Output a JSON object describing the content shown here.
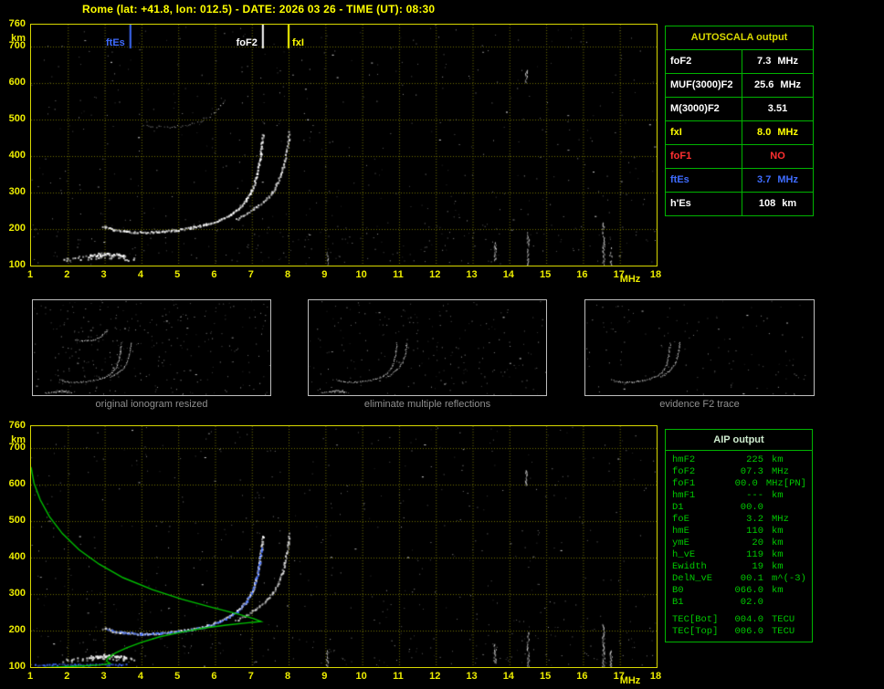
{
  "title": "Rome (lat: +41.8, lon: 012.5) - DATE: 2026 03 26 - TIME (UT): 08:30",
  "colors": {
    "frame": "#d8d800",
    "grid": "#6f6f00",
    "tick": "#ecec00",
    "trace": "#e0e0e0",
    "noise": "#a8a8a8",
    "profile": "#00c000",
    "fit": "#3f6cff",
    "table_green": "#00b400",
    "caption": "#8f8f8f"
  },
  "axes": {
    "f_min": 1,
    "f_max": 18,
    "h_min": 100,
    "h_max": 760,
    "x_ticks": [
      1,
      2,
      3,
      4,
      5,
      6,
      7,
      8,
      9,
      10,
      11,
      12,
      13,
      14,
      15,
      16,
      17,
      18
    ],
    "y_ticks": [
      760,
      700,
      600,
      500,
      400,
      300,
      200,
      100
    ],
    "x_unit": "MHz",
    "y_unit": "km"
  },
  "markers": [
    {
      "label": "ftEs",
      "f": 3.7,
      "color": "#3f6cff",
      "side": "left"
    },
    {
      "label": "foF2",
      "f": 7.3,
      "color": "#ffffff",
      "side": "left"
    },
    {
      "label": "fxI",
      "f": 8.0,
      "color": "#ffff00",
      "side": "right"
    }
  ],
  "autoscala": {
    "title": "AUTOSCALA output",
    "rows": [
      {
        "label": "foF2",
        "value": "7.3",
        "unit": "MHz",
        "color": "#ffffff"
      },
      {
        "label": "MUF(3000)F2",
        "value": "25.6",
        "unit": "MHz",
        "color": "#ffffff"
      },
      {
        "label": "M(3000)F2",
        "value": "3.51",
        "unit": "",
        "color": "#ffffff"
      },
      {
        "label": "fxI",
        "value": "8.0",
        "unit": "MHz",
        "color": "#ffff00"
      },
      {
        "label": "foF1",
        "value": "NO",
        "unit": "",
        "color": "#ff3030"
      },
      {
        "label": "ftEs",
        "value": "3.7",
        "unit": "MHz",
        "color": "#3f6cff"
      },
      {
        "label": "h'Es",
        "value": "108",
        "unit": "km",
        "color": "#ffffff"
      }
    ]
  },
  "thumbs": [
    {
      "caption": "original ionogram resized"
    },
    {
      "caption": "eliminate multiple reflections"
    },
    {
      "caption": "evidence F2 trace"
    }
  ],
  "aip": {
    "title": "AIP output",
    "rows": [
      {
        "label": "hmF2",
        "value": "225",
        "unit": "km",
        "extra": ""
      },
      {
        "label": "foF2",
        "value": "07.3",
        "unit": "MHz",
        "extra": ""
      },
      {
        "label": "foF1",
        "value": "00.0",
        "unit": "MHz",
        "extra": "[PN]"
      },
      {
        "label": "hmF1",
        "value": "---",
        "unit": "km",
        "extra": ""
      },
      {
        "label": "D1",
        "value": "00.0",
        "unit": "",
        "extra": ""
      },
      {
        "label": "foE",
        "value": "3.2",
        "unit": "MHz",
        "extra": ""
      },
      {
        "label": "hmE",
        "value": "110",
        "unit": "km",
        "extra": ""
      },
      {
        "label": "ymE",
        "value": "20",
        "unit": "km",
        "extra": ""
      },
      {
        "label": "h_vE",
        "value": "119",
        "unit": "km",
        "extra": ""
      },
      {
        "label": "Ewidth",
        "value": "19",
        "unit": "km",
        "extra": ""
      },
      {
        "label": "DelN_vE",
        "value": "00.1",
        "unit": "m^(-3)",
        "extra": ""
      },
      {
        "label": "B0",
        "value": "066.0",
        "unit": "km",
        "extra": ""
      },
      {
        "label": "B1",
        "value": "02.0",
        "unit": "",
        "extra": ""
      }
    ],
    "tec_rows": [
      {
        "label": "TEC[Bot]",
        "value": "004.0",
        "unit": "TECU",
        "extra": ""
      },
      {
        "label": "TEC[Top]",
        "value": "006.0",
        "unit": "TECU",
        "extra": ""
      }
    ]
  },
  "ionogram": {
    "traces": {
      "es_layer": [
        [
          1.85,
          118
        ],
        [
          2.15,
          121
        ],
        [
          2.5,
          124
        ],
        [
          2.85,
          126
        ],
        [
          3.2,
          126
        ],
        [
          3.5,
          123
        ],
        [
          3.78,
          119
        ]
      ],
      "es_blob": [
        [
          2.6,
          128
        ],
        [
          2.85,
          132
        ],
        [
          3.1,
          134
        ],
        [
          3.35,
          131
        ],
        [
          3.55,
          127
        ]
      ],
      "f_ordinary": [
        [
          2.95,
          208
        ],
        [
          3.25,
          199
        ],
        [
          3.6,
          194
        ],
        [
          4.0,
          192
        ],
        [
          4.45,
          194
        ],
        [
          4.9,
          198
        ],
        [
          5.35,
          205
        ],
        [
          5.75,
          214
        ],
        [
          6.1,
          226
        ],
        [
          6.4,
          241
        ],
        [
          6.65,
          260
        ],
        [
          6.85,
          283
        ],
        [
          7.0,
          310
        ],
        [
          7.1,
          340
        ],
        [
          7.17,
          372
        ],
        [
          7.22,
          405
        ],
        [
          7.26,
          437
        ],
        [
          7.285,
          462
        ]
      ],
      "f_extra": [
        [
          6.55,
          228
        ],
        [
          6.85,
          244
        ],
        [
          7.1,
          261
        ],
        [
          7.35,
          281
        ],
        [
          7.55,
          304
        ],
        [
          7.7,
          330
        ],
        [
          7.8,
          357
        ],
        [
          7.88,
          386
        ],
        [
          7.94,
          416
        ],
        [
          7.98,
          444
        ],
        [
          8.0,
          466
        ]
      ],
      "second_hop": [
        [
          4.05,
          484
        ],
        [
          4.45,
          481
        ],
        [
          4.9,
          481
        ],
        [
          5.3,
          487
        ],
        [
          5.65,
          499
        ],
        [
          5.95,
          517
        ],
        [
          6.15,
          537
        ],
        [
          6.28,
          554
        ]
      ],
      "profile": [
        [
          1.0,
          97
        ],
        [
          1.7,
          100
        ],
        [
          2.4,
          103
        ],
        [
          2.9,
          106
        ],
        [
          3.15,
          110
        ],
        [
          3.05,
          117
        ],
        [
          3.1,
          126
        ],
        [
          3.3,
          139
        ],
        [
          3.6,
          153
        ],
        [
          4.0,
          168
        ],
        [
          4.5,
          183
        ],
        [
          5.1,
          196
        ],
        [
          5.7,
          207
        ],
        [
          6.3,
          215
        ],
        [
          6.85,
          221
        ],
        [
          7.25,
          225
        ],
        [
          7.05,
          233
        ],
        [
          6.6,
          246
        ],
        [
          5.9,
          264
        ],
        [
          5.1,
          286
        ],
        [
          4.3,
          312
        ],
        [
          3.5,
          345
        ],
        [
          2.85,
          382
        ],
        [
          2.3,
          422
        ],
        [
          1.85,
          466
        ],
        [
          1.5,
          512
        ],
        [
          1.25,
          558
        ],
        [
          1.08,
          604
        ],
        [
          1.0,
          648
        ]
      ],
      "fit_f": [
        [
          3.05,
          203
        ],
        [
          3.5,
          196
        ],
        [
          4.0,
          192
        ],
        [
          4.5,
          194
        ],
        [
          5.0,
          199
        ],
        [
          5.5,
          207
        ],
        [
          5.95,
          218
        ],
        [
          6.3,
          234
        ],
        [
          6.6,
          254
        ],
        [
          6.85,
          280
        ],
        [
          7.02,
          312
        ],
        [
          7.12,
          348
        ],
        [
          7.2,
          388
        ],
        [
          7.25,
          428
        ]
      ],
      "fit_es": [
        [
          1.1,
          108
        ],
        [
          1.6,
          108
        ],
        [
          2.1,
          108
        ],
        [
          2.6,
          108
        ],
        [
          3.1,
          108
        ],
        [
          3.55,
          108
        ]
      ]
    },
    "streaks": [
      {
        "f": 14.5,
        "h1": 100,
        "h2": 196
      },
      {
        "f": 14.45,
        "h1": 600,
        "h2": 640
      },
      {
        "f": 16.55,
        "h1": 100,
        "h2": 218
      },
      {
        "f": 16.75,
        "h1": 100,
        "h2": 150
      },
      {
        "f": 13.6,
        "h1": 112,
        "h2": 164
      },
      {
        "f": 9.05,
        "h1": 104,
        "h2": 146
      }
    ]
  }
}
